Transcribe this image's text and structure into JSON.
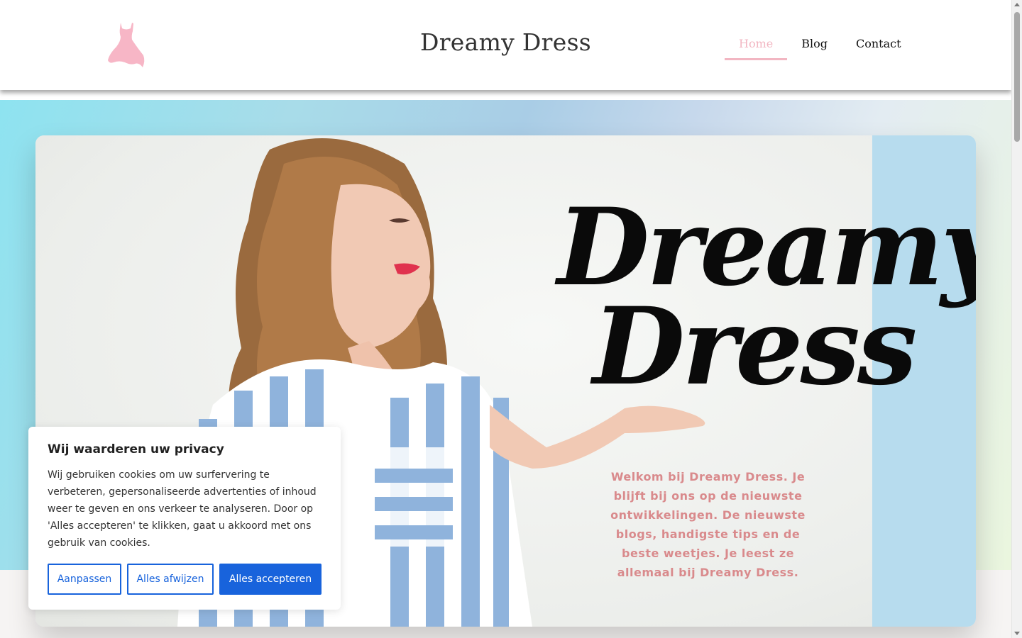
{
  "header": {
    "site_title": "Dreamy Dress",
    "logo_icon": "dress-icon",
    "logo_color": "#f7b6c6",
    "nav": [
      {
        "label": "Home",
        "active": true
      },
      {
        "label": "Blog",
        "active": false
      },
      {
        "label": "Contact",
        "active": false
      }
    ]
  },
  "hero": {
    "script_title_line1": "Dreamy",
    "script_title_line2": "Dress",
    "welcome_text": "Welkom bij Dreamy Dress. Je blijft bij ons op de nieuwste ontwikkelingen. De nieuwste blogs, handigste tips en de beste weetjes. Je leest ze allemaal bij Dreamy Dress.",
    "text_color": "#d98a8c",
    "side_panel_color": "#b7dcee"
  },
  "cookie_banner": {
    "title": "Wij waarderen uw privacy",
    "text": "Wij gebruiken cookies om uw surfervering te verbeteren,  gepersonaliseerde advertenties of inhoud weer te geven en ons verkeer te analyseren. Door op 'Alles accepteren' te klikken, gaat u akkoord met ons gebruik van cookies.",
    "buttons": {
      "customize": "Aanpassen",
      "reject_all": "Alles afwijzen",
      "accept_all": "Alles accepteren"
    },
    "accent_color": "#1863dc"
  }
}
